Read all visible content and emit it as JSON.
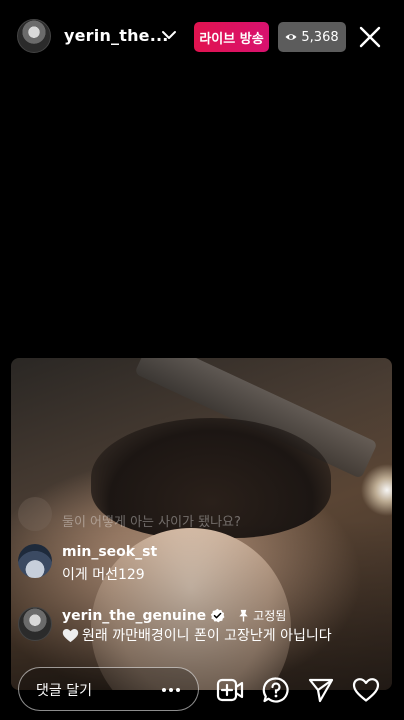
{
  "header": {
    "username": "yerin_the...",
    "live_label": "라이브 방송",
    "viewer_count": "5,368"
  },
  "comments": {
    "faded": {
      "username": " ",
      "text": "둘이 어떻게 아는 사이가 됐나요?"
    },
    "items": [
      {
        "username": "min_seok_st",
        "text": "이게 머선129"
      },
      {
        "username": "yerin_the_genuine",
        "pinned_label": "고정됨",
        "text": "원래 까만배경이니 폰이 고장난게 아닙니다"
      }
    ]
  },
  "footer": {
    "comment_placeholder": "댓글 달기"
  },
  "icons": {
    "header": [
      "chevron-down-icon",
      "eye-icon",
      "close-icon"
    ],
    "comment": [
      "verified-icon",
      "pin-icon",
      "heart-icon"
    ],
    "footer": [
      "more-icon",
      "add-video-icon",
      "question-icon",
      "send-icon",
      "heart-icon"
    ]
  },
  "colors": {
    "live": "#e1134f",
    "viewer_badge": "#5c5c5c",
    "verified": "#ffffff"
  }
}
